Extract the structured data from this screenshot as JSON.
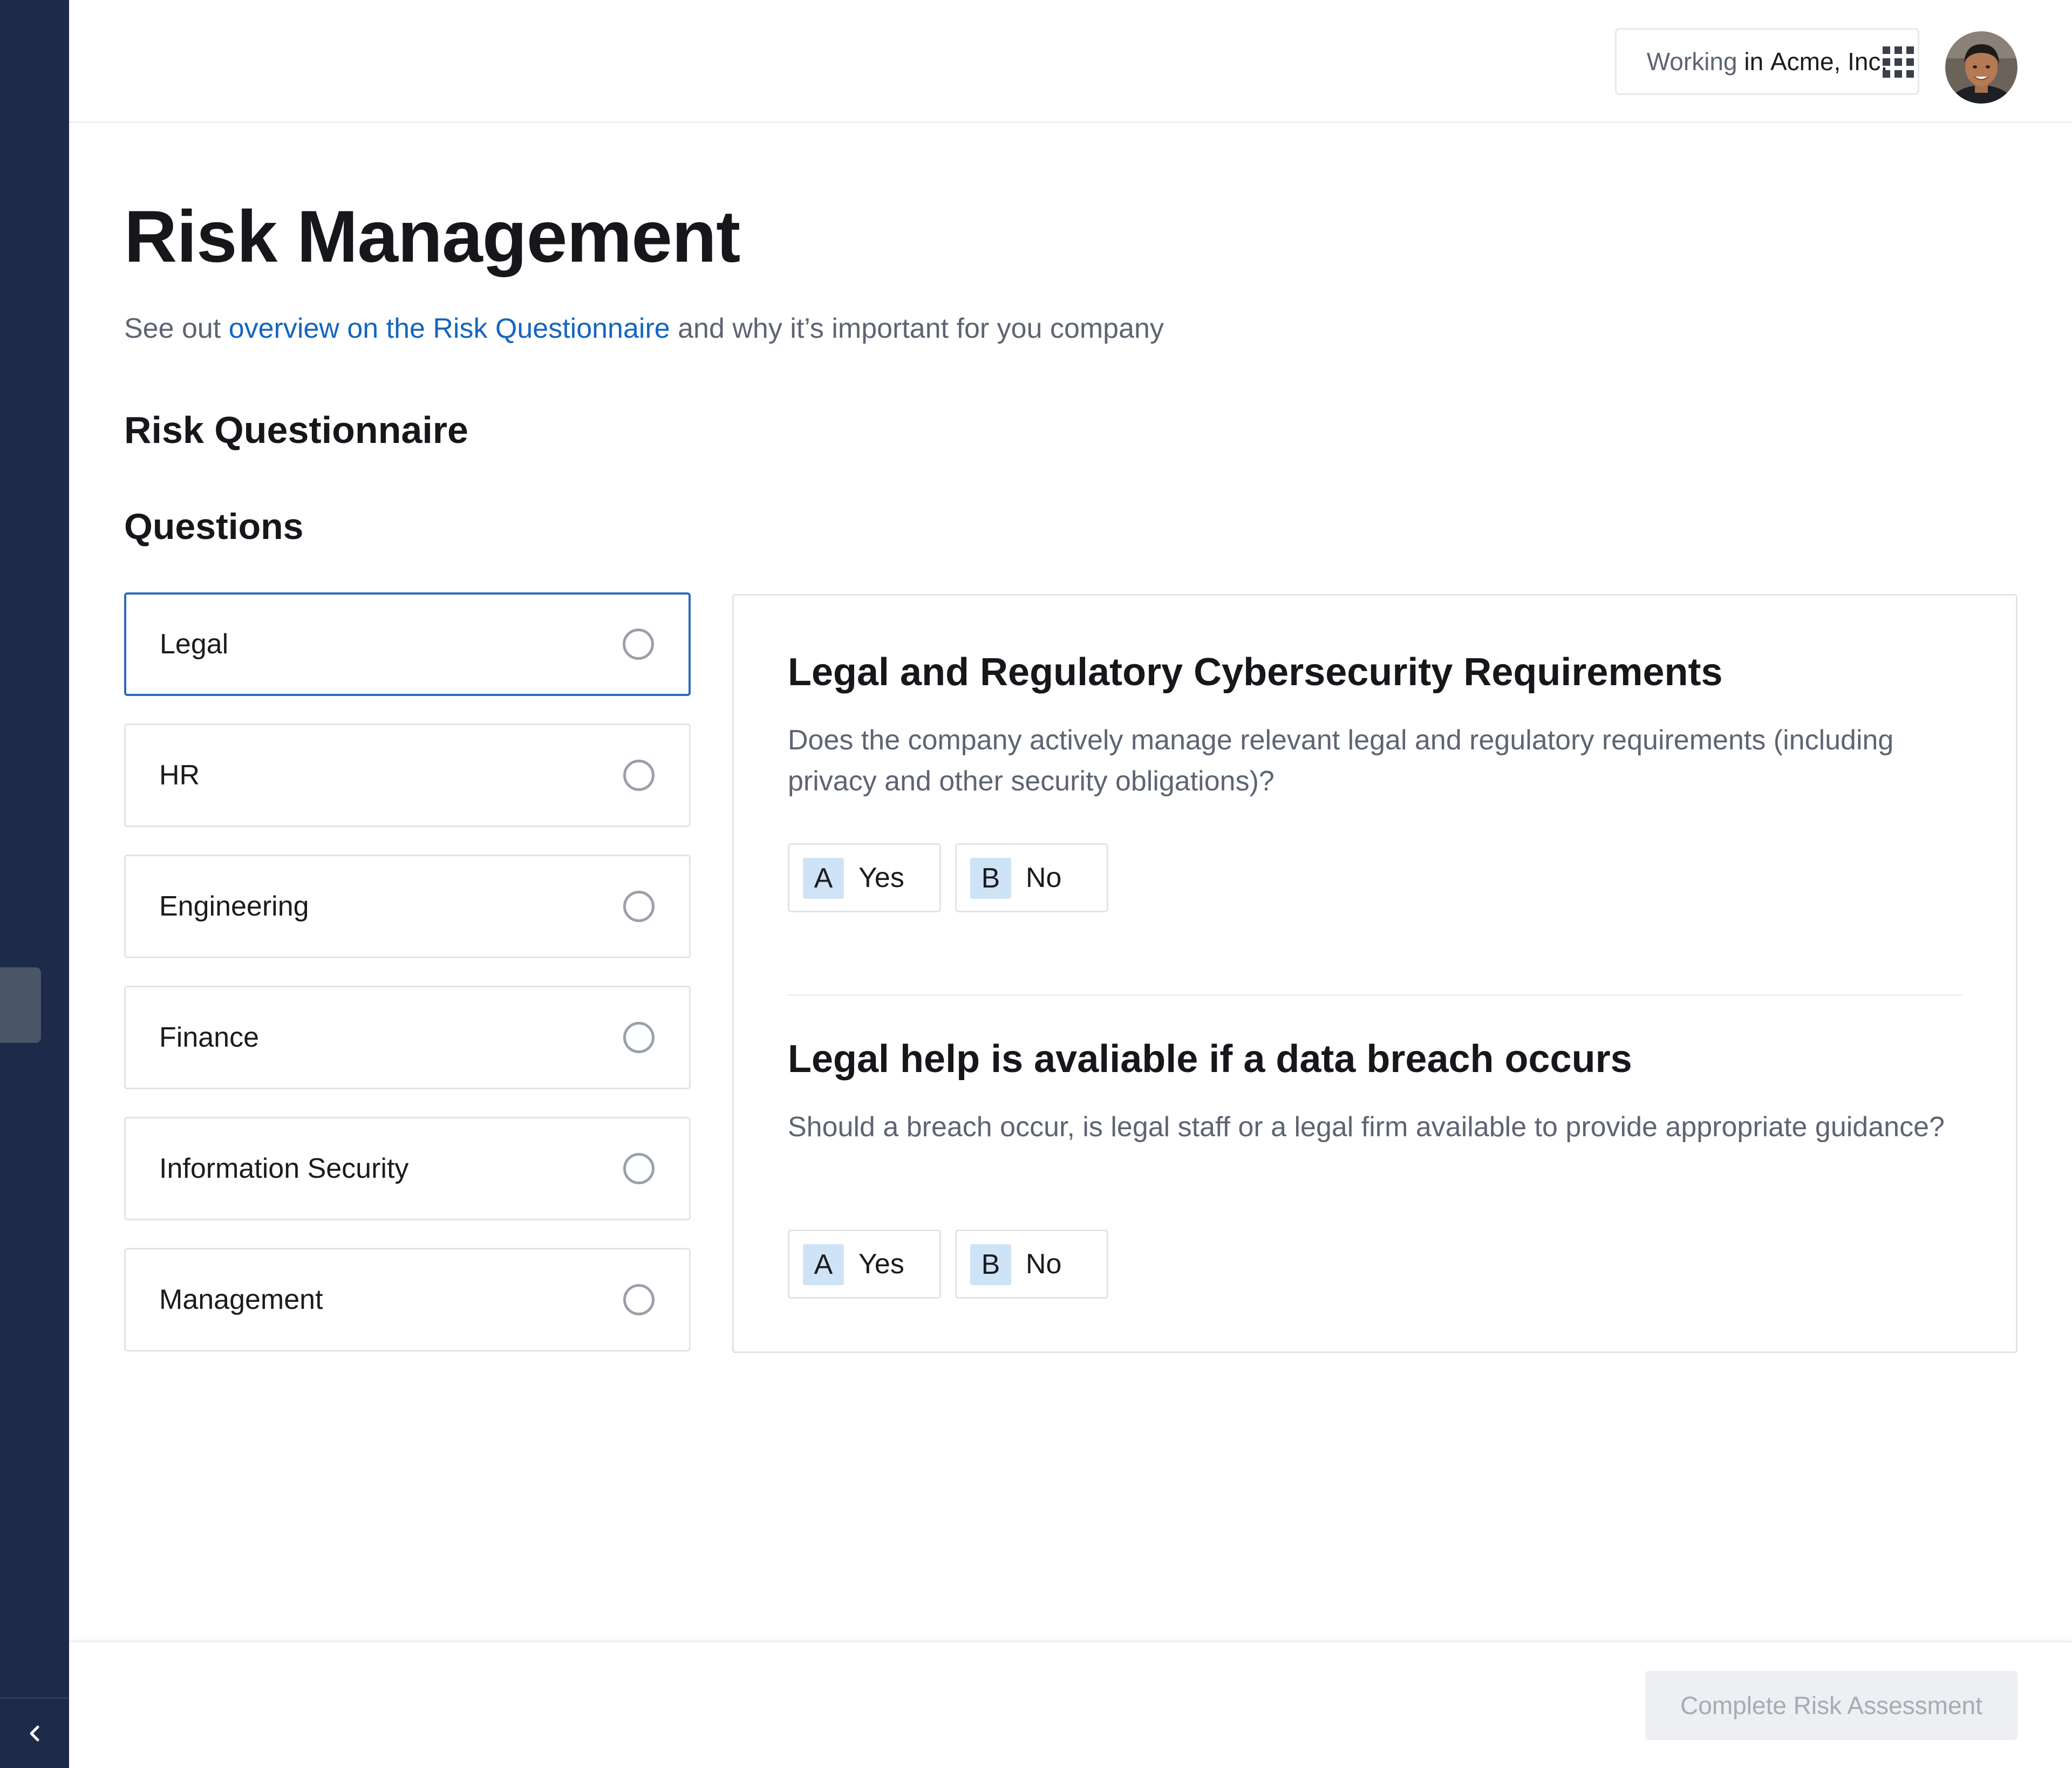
{
  "header": {
    "org_prefix": "Working",
    "org_in": " in ",
    "org_name": "Acme, Inc.",
    "apps_icon": "grid-apps-icon",
    "avatar_icon": "user-avatar"
  },
  "page": {
    "title": "Risk Management",
    "subtitle_before": "See out ",
    "subtitle_link": "overview on the Risk Questionnaire",
    "subtitle_after": " and why it’s important for you company",
    "section_title": "Risk Questionnaire",
    "subsection_title": "Questions"
  },
  "categories": [
    {
      "label": "Legal",
      "active": true
    },
    {
      "label": "HR",
      "active": false
    },
    {
      "label": "Engineering",
      "active": false
    },
    {
      "label": "Finance",
      "active": false
    },
    {
      "label": "Information Security",
      "active": false
    },
    {
      "label": "Management",
      "active": false
    }
  ],
  "questions": [
    {
      "title": "Legal and Regulatory Cybersecurity Requirements",
      "description": "Does the company actively manage relevant legal and regulatory requirements (including privacy and other security obligations)?",
      "answers": [
        {
          "key": "A",
          "label": "Yes"
        },
        {
          "key": "B",
          "label": "No"
        }
      ]
    },
    {
      "title": "Legal help is avaliable if a data breach occurs",
      "description": "Should a breach occur, is legal staff or a legal firm available to provide appropriate guidance?",
      "answers": [
        {
          "key": "A",
          "label": "Yes"
        },
        {
          "key": "B",
          "label": "No"
        }
      ]
    }
  ],
  "footer": {
    "complete_label": "Complete Risk Assessment"
  },
  "colors": {
    "rail": "#1e2a4a",
    "link": "#1466c0",
    "active_border": "#2e69b6",
    "answer_key_bg": "#cfe3f7"
  }
}
